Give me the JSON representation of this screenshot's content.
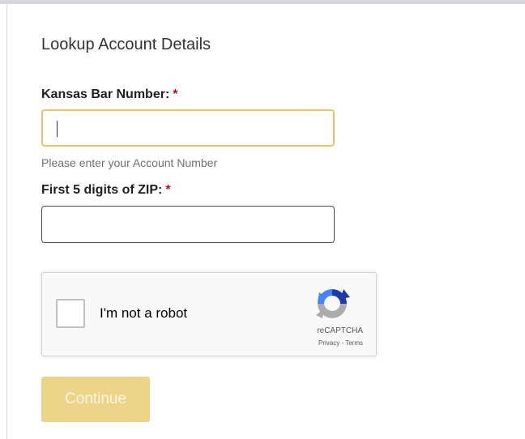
{
  "form": {
    "heading": "Lookup Account Details",
    "bar_number": {
      "label": "Kansas Bar Number:",
      "required_marker": "*",
      "value": "",
      "hint": "Please enter your Account Number"
    },
    "zip": {
      "label": "First 5 digits of ZIP:",
      "required_marker": "*",
      "value": ""
    },
    "recaptcha": {
      "checkbox_label": "I'm not a robot",
      "brand": "reCAPTCHA",
      "privacy_link": "Privacy",
      "separator": " - ",
      "terms_link": "Terms",
      "checked": false
    },
    "submit": {
      "label": "Continue"
    }
  },
  "colors": {
    "accent_border": "#e3c46a",
    "button_bg": "#ecd489",
    "required": "#b1121a"
  }
}
